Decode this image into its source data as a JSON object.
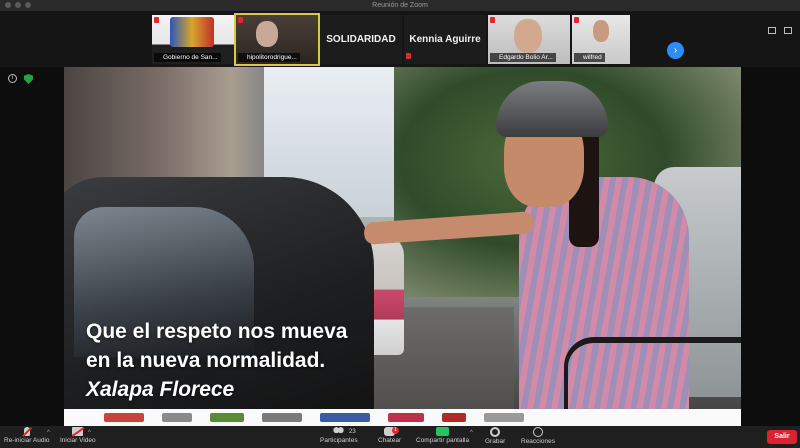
{
  "window": {
    "title": "Reunión de Zoom"
  },
  "participants_strip": {
    "tiles": [
      {
        "name": "Gobierno de San..."
      },
      {
        "name": "hipolitorodrigue..."
      },
      {
        "name": "SOLIDARIDAD",
        "display_text": "SOLIDARIDAD"
      },
      {
        "name": "Kennia Aguirre",
        "display_text": "Kennia Aguirre"
      },
      {
        "name": "Edgardo Bolio Ar..."
      },
      {
        "name": "wilfred"
      }
    ],
    "next_page_icon": "chevron-right-icon"
  },
  "shared_content": {
    "slogan_line1": "Que el respeto nos mueva",
    "slogan_line2": "en la nueva normalidad.",
    "slogan_line3": "Xalapa Florece"
  },
  "toolbar": {
    "audio_label": "Re-iniciar Audio",
    "video_label": "Iniciar Video",
    "participants_label": "Participantes",
    "participants_count": "23",
    "chat_label": "Chatear",
    "chat_badge": "1",
    "share_label": "Compartir pantalla",
    "record_label": "Grabar",
    "reactions_label": "Reacciones",
    "leave_label": "Salir"
  },
  "colors": {
    "accent_blue": "#2d8cff",
    "share_green": "#27c264",
    "leave_red": "#d9232e",
    "muted_red": "#e02828"
  }
}
